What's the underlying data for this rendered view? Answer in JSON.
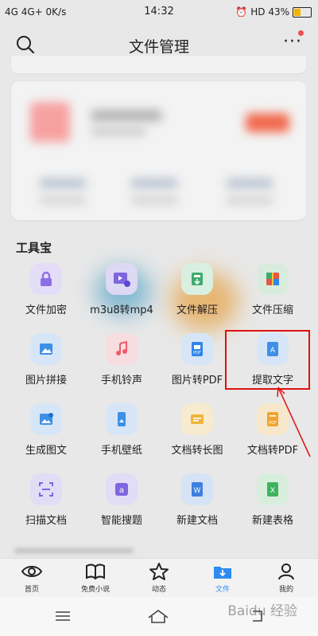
{
  "status_bar": {
    "signal_left": "4G\u0000\u0000\u0000 4G+\u0000\u0000\u0000 0K/s",
    "signal_text": "4G    4G+    0K/s",
    "time": "14:32",
    "right": "HD 43%"
  },
  "header": {
    "title": "文件管理",
    "more": "···"
  },
  "tools": {
    "section_title": "工具宝",
    "items": [
      {
        "label": "文件加密",
        "icon": "lock-icon",
        "color": "#9a7de8"
      },
      {
        "label": "m3u8转mp4",
        "icon": "video-convert-icon",
        "color": "#8b73e0"
      },
      {
        "label": "文件解压",
        "icon": "unzip-icon",
        "color": "#47b07a"
      },
      {
        "label": "文件压缩",
        "icon": "zip-icon",
        "color": "#e15c4b"
      },
      {
        "label": "图片拼接",
        "icon": "image-icon",
        "color": "#3f8fe6"
      },
      {
        "label": "手机铃声",
        "icon": "music-icon",
        "color": "#ef5b6b"
      },
      {
        "label": "图片转PDF",
        "icon": "pdf-icon",
        "color": "#2f86e8"
      },
      {
        "label": "提取文字",
        "icon": "extract-text-icon",
        "color": "#3f8fe6"
      },
      {
        "label": "生成图文",
        "icon": "image-text-icon",
        "color": "#3f8fe6"
      },
      {
        "label": "手机壁纸",
        "icon": "phone-wallpaper-icon",
        "color": "#3f8fe6"
      },
      {
        "label": "文档转长图",
        "icon": "doc-long-image-icon",
        "color": "#f0b53a"
      },
      {
        "label": "文档转PDF",
        "icon": "doc-pdf-icon",
        "color": "#f0a52e"
      },
      {
        "label": "扫描文档",
        "icon": "scan-icon",
        "color": "#8b73e0"
      },
      {
        "label": "智能搜题",
        "icon": "smart-search-icon",
        "color": "#8b73e0"
      },
      {
        "label": "新建文档",
        "icon": "word-doc-icon",
        "color": "#3f7fe0"
      },
      {
        "label": "新建表格",
        "icon": "excel-icon",
        "color": "#3fb35f"
      }
    ]
  },
  "bottom_nav": {
    "tabs": [
      {
        "label": "首页",
        "icon": "eye-icon"
      },
      {
        "label": "免费小说",
        "icon": "book-icon"
      },
      {
        "label": "动态",
        "icon": "star-icon"
      },
      {
        "label": "文件",
        "icon": "file-download-icon"
      },
      {
        "label": "我的",
        "icon": "user-icon"
      }
    ]
  },
  "watermark": "Baidu 经验",
  "colors": {
    "accent": "#2d8cf0",
    "highlight": "#d11111"
  }
}
